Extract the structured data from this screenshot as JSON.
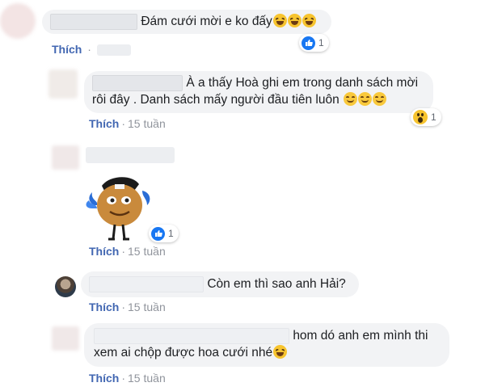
{
  "comments": [
    {
      "text": "Đám cưới mời e ko đấy",
      "reaction_count": "1",
      "action_like": "Thích",
      "action_sep": "·",
      "time": ""
    },
    {
      "text_line1": "À a thấy Hoà ghi em trong danh sách mời",
      "text_line2": "rôi đây . Danh sách mấy người đầu tiên luôn",
      "reaction_count": "1",
      "action_like": "Thích",
      "action_sep": "·",
      "time": "15 tuần"
    },
    {
      "sticker": "emoji-movie-character",
      "reaction_count": "1",
      "action_like": "Thích",
      "action_sep": "·",
      "time": "15 tuần"
    },
    {
      "text": "Còn em thì sao anh Hải?",
      "action_like": "Thích",
      "action_sep": "·",
      "time": "15 tuần"
    },
    {
      "text_line1": "hom dó anh em mình thi",
      "text_line2": "xem ai chộp được hoa cưới nhé",
      "action_like": "Thích",
      "action_sep": "·",
      "time": "15 tuần"
    }
  ],
  "colors": {
    "like_link": "#4267b2",
    "meta_text": "#90949c",
    "bubble_bg": "#f2f3f5",
    "like_reaction": "#1877f2"
  }
}
